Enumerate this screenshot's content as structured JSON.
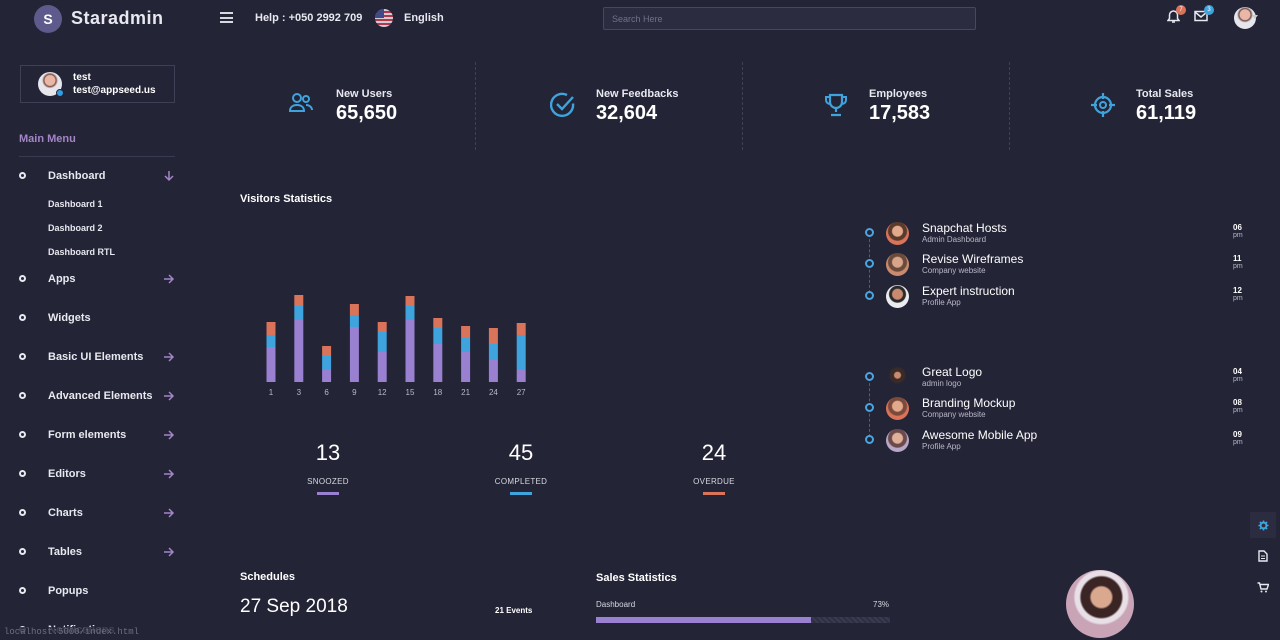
{
  "brand": {
    "logo_letter": "S",
    "name": "Staradmin"
  },
  "navbar": {
    "help": "Help : +050 2992 709",
    "language": "English",
    "search_placeholder": "Search Here",
    "notifications_count": "7",
    "messages_count": "3"
  },
  "user": {
    "name": "test",
    "email": "test@appseed.us"
  },
  "sidebar": {
    "menu_title": "Main Menu",
    "items": [
      {
        "label": "Dashboard",
        "expanded": true
      },
      {
        "label": "Apps"
      },
      {
        "label": "Widgets"
      },
      {
        "label": "Basic UI Elements"
      },
      {
        "label": "Advanced Elements"
      },
      {
        "label": "Form elements"
      },
      {
        "label": "Editors"
      },
      {
        "label": "Charts"
      },
      {
        "label": "Tables"
      },
      {
        "label": "Popups"
      },
      {
        "label": "Notifications"
      }
    ],
    "sub_items": [
      "Dashboard 1",
      "Dashboard 2",
      "Dashboard RTL"
    ]
  },
  "stats": [
    {
      "label": "New Users",
      "value": "65,650",
      "icon": "users-icon"
    },
    {
      "label": "New Feedbacks",
      "value": "32,604",
      "icon": "check-circle-icon"
    },
    {
      "label": "Employees",
      "value": "17,583",
      "icon": "trophy-icon"
    },
    {
      "label": "Total Sales",
      "value": "61,119",
      "icon": "crosshair-icon"
    }
  ],
  "visitors": {
    "title": "Visitors Statistics",
    "kpis": [
      {
        "value": "13",
        "label": "SNOOZED",
        "color": "#9a80d0"
      },
      {
        "value": "45",
        "label": "COMPLETED",
        "color": "#3fa3dd"
      },
      {
        "value": "24",
        "label": "OVERDUE",
        "color": "#d9735a"
      }
    ]
  },
  "chart_data": {
    "type": "bar",
    "stacked": true,
    "categories": [
      "1",
      "3",
      "6",
      "9",
      "12",
      "15",
      "18",
      "21",
      "24",
      "27"
    ],
    "series": [
      {
        "values": [
          35,
          62,
          12,
          55,
          30,
          62,
          38,
          30,
          22,
          12
        ]
      },
      {
        "values": [
          12,
          14,
          14,
          12,
          20,
          14,
          16,
          14,
          16,
          35
        ]
      },
      {
        "values": [
          13,
          11,
          10,
          11,
          10,
          10,
          10,
          12,
          16,
          12
        ]
      }
    ],
    "colors": [
      "#9a80d0",
      "#3fa3dd",
      "#d9735a"
    ],
    "grid": false
  },
  "timeline": [
    {
      "title": "Snapchat Hosts",
      "subtitle": "Admin Dashboard",
      "time": "06",
      "period": "pm"
    },
    {
      "title": "Revise Wireframes",
      "subtitle": "Company website",
      "time": "11",
      "period": "pm"
    },
    {
      "title": "Expert instruction",
      "subtitle": "Profile App",
      "time": "12",
      "period": "pm"
    },
    {
      "title": "Great Logo",
      "subtitle": "admin logo",
      "time": "04",
      "period": "pm"
    },
    {
      "title": "Branding Mockup",
      "subtitle": "Company website",
      "time": "08",
      "period": "pm"
    },
    {
      "title": "Awesome Mobile App",
      "subtitle": "Profile App",
      "time": "09",
      "period": "pm"
    }
  ],
  "schedules": {
    "title": "Schedules",
    "date": "27 Sep 2018",
    "events": "21 Events"
  },
  "sales": {
    "title": "Sales Statistics",
    "label": "Dashboard",
    "percent_text": "73%",
    "percent": 73
  },
  "status_url": "localhost:5000/index.html"
}
